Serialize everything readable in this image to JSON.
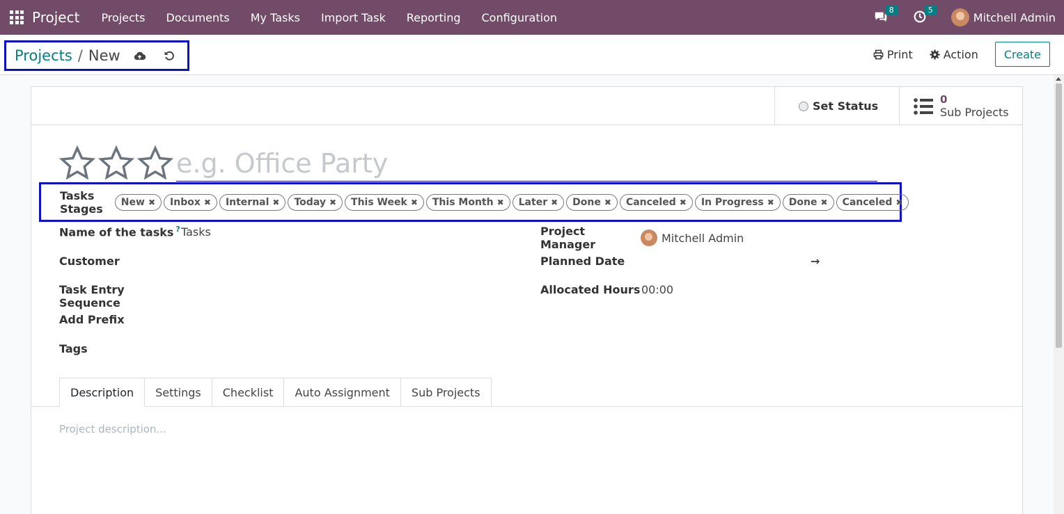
{
  "navbar": {
    "brand": "Project",
    "menu": [
      "Projects",
      "Documents",
      "My Tasks",
      "Import Task",
      "Reporting",
      "Configuration"
    ],
    "messages_count": "8",
    "activities_count": "5",
    "user": "Mitchell Admin"
  },
  "control": {
    "breadcrumb_parent": "Projects",
    "breadcrumb_sep": "/",
    "breadcrumb_current": "New",
    "print_label": "Print",
    "action_label": "Action",
    "create_label": "Create"
  },
  "statusbar": {
    "set_status": "Set Status",
    "sub_projects_count": "0",
    "sub_projects_label": "Sub Projects"
  },
  "form": {
    "name_placeholder": "e.g. Office Party",
    "stages_label": "Tasks Stages",
    "stages": [
      "New",
      "Inbox",
      "Internal",
      "Today",
      "This Week",
      "This Month",
      "Later",
      "Done",
      "Canceled",
      "In Progress",
      "Done",
      "Canceled"
    ],
    "name_of_tasks_label": "Name of the tasks",
    "name_of_tasks_help": "?",
    "name_of_tasks_value": "Tasks",
    "customer_label": "Customer",
    "task_entry_sequence_label": "Task Entry Sequence",
    "add_prefix_label": "Add Prefix",
    "tags_label": "Tags",
    "project_manager_label": "Project Manager",
    "project_manager_value": "Mitchell Admin",
    "planned_date_label": "Planned Date",
    "planned_date_arrow": "→",
    "allocated_hours_label": "Allocated Hours",
    "allocated_hours_value": "00:00"
  },
  "tabs": [
    "Description",
    "Settings",
    "Checklist",
    "Auto Assignment",
    "Sub Projects"
  ],
  "description_placeholder": "Project description...",
  "colors": {
    "navbar": "#714b67",
    "accent": "#017e84",
    "highlight_box": "#1010c8"
  }
}
